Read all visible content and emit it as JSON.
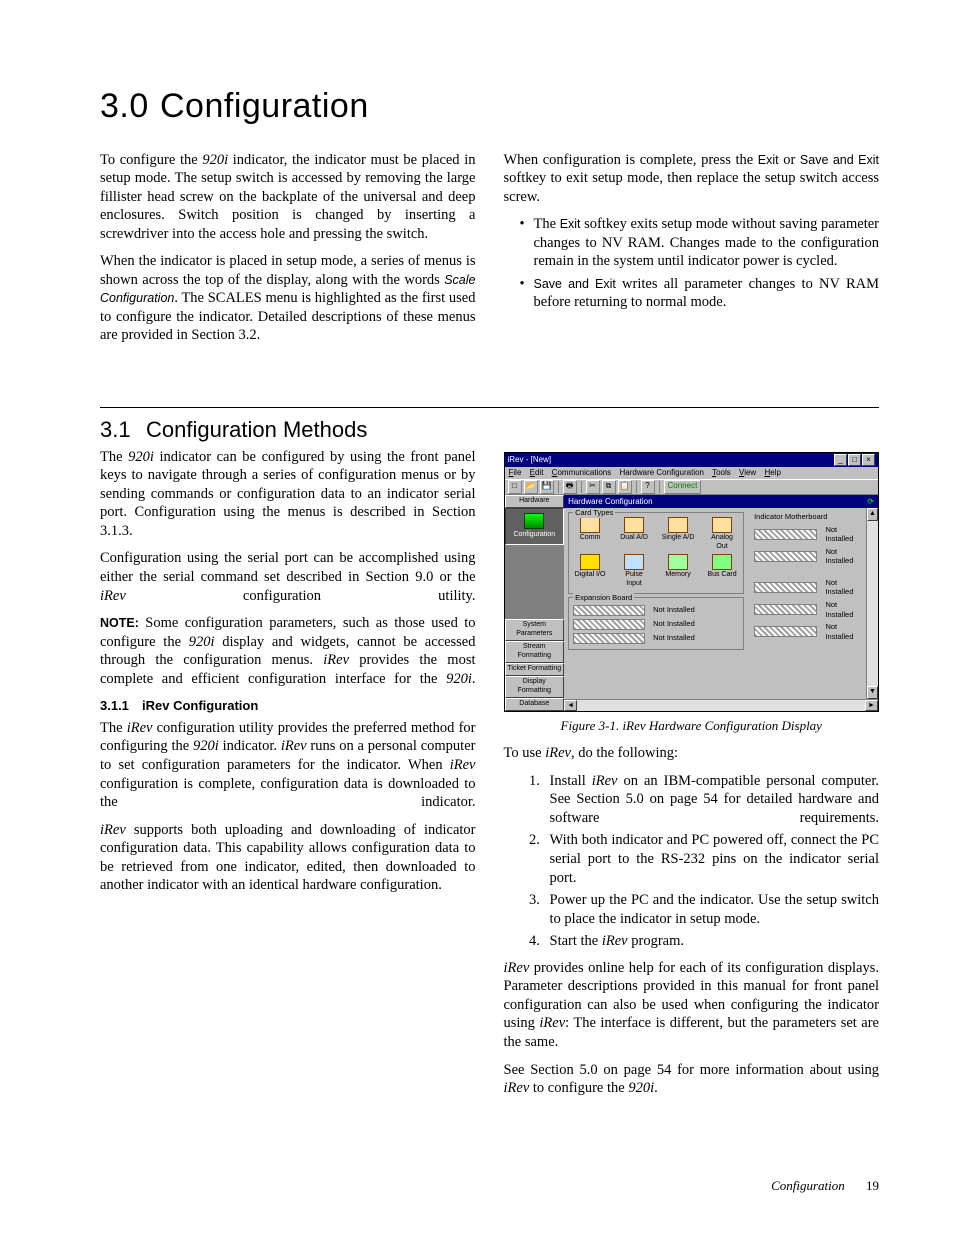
{
  "heading": {
    "num": "3.0",
    "title": "Configuration"
  },
  "intro": {
    "p1a": "To configure the ",
    "p1b": "920i",
    "p1c": " indicator, the indicator must be placed in setup mode. The setup switch is accessed by removing the large fillister head screw on the backplate of the universal and deep enclosures. Switch position is changed by inserting a screwdriver into the access hole and pressing the switch.",
    "p2a": "When the indicator is placed in setup mode, a series of menus is shown across the top of the display, along with the words ",
    "p2b": "Scale Configuration",
    "p2c": ". The SCALES menu is highlighted as the first used to configure the indicator. Detailed descriptions of these menus are provided in Section 3.2.",
    "rp1a": "When configuration is complete, press the ",
    "rp1b": "Exit",
    "rp1c": " or ",
    "rp1d": "Save and Exit",
    "rp1e": " softkey to exit setup mode, then replace the setup switch access screw.",
    "b1a": "The ",
    "b1b": "Exit",
    "b1c": " softkey exits setup mode without saving parameter changes to NV RAM. Changes made to the configuration remain in the system until indicator power is cycled.",
    "b2a": "Save and Exit",
    "b2b": " writes all parameter changes to NV RAM before returning to normal mode."
  },
  "sec31": {
    "num": "3.1",
    "title": "Configuration Methods",
    "p1a": "The ",
    "p1b": "920i",
    "p1c": " indicator can be configured by using the front panel keys to navigate through a series of configuration menus or by sending commands or configuration data to an indicator serial port. Configuration using the menus is described in Section 3.1.3.",
    "p2a": "Configuration using the serial port can be accomplished using either the serial command set described in Section 9.0 or the ",
    "p2b": "iRev",
    "p2c": " configuration utility.",
    "p3a": "NOTE:",
    "p3b": " Some configuration parameters, such as those used to configure the ",
    "p3c": "920i",
    "p3d": " display and widgets, cannot be accessed through the configuration menus. ",
    "p3e": "iRev",
    "p3f": " provides the most complete and efficient configuration interface for the ",
    "p3g": "920i",
    "p3h": "."
  },
  "sec311": {
    "num": "3.1.1",
    "title": "iRev Configuration",
    "p1a": "The ",
    "p1b": "iRev",
    "p1c": " configuration utility provides the preferred method for configuring the ",
    "p1d": "920i",
    "p1e": " indicator. ",
    "p1f": "iRev",
    "p1g": " runs on a personal computer to set configuration parameters for the indicator. When ",
    "p1h": "iRev",
    "p1i": " configuration is complete, configuration data is downloaded to the indicator.",
    "p2a": "iRev",
    "p2b": " supports both uploading and downloading of indicator configuration data. This capability allows configuration data to be retrieved from one indicator, edited, then downloaded to another indicator with an identical hardware configuration."
  },
  "fig": {
    "caption": "Figure 3-1. iRev Hardware Configuration Display",
    "title": "iRev - [New]",
    "menus": [
      "File",
      "Edit",
      "Communications",
      "Hardware Configuration",
      "Tools",
      "View",
      "Help"
    ],
    "connect": "Connect",
    "side_top": "Hardware",
    "side_conf": "Configuration",
    "side_items": [
      "System Parameters",
      "Stream Formatting",
      "Ticket Formatting",
      "Display Formatting",
      "Database"
    ],
    "content_title": "Hardware Configuration",
    "card_types": "Card Types",
    "icons": [
      "Comm",
      "Dual A/D",
      "Single A/D",
      "Analog Out",
      "Digital I/O",
      "Pulse Input",
      "Memory",
      "Bus Card"
    ],
    "exp_board": "Expansion Board",
    "mb": "Indicator Motherboard",
    "ni": "Not Installed"
  },
  "usage": {
    "lead_a": "To use ",
    "lead_b": "iRev",
    "lead_c": ", do the following:",
    "s1a": "Install ",
    "s1b": "iRev",
    "s1c": " on an IBM-compatible personal computer. See Section 5.0 on page 54 for detailed hardware and software requirements.",
    "s2": "With both indicator and PC powered off, connect the PC serial port to the RS-232 pins on the indicator serial port.",
    "s3": "Power up the PC and the indicator. Use the setup switch to place the indicator in setup mode.",
    "s4a": "Start the ",
    "s4b": "iRev",
    "s4c": " program.",
    "p_after_a": "iRev",
    "p_after_b": " provides online help for each of its configuration displays. Parameter descriptions provided in this manual for front panel configuration can also be used when configuring the indicator using ",
    "p_after_c": "iRev",
    "p_after_d": ": The interface is different, but the parameters set are the same.",
    "p_last_a": "See Section 5.0 on page 54 for more information about using ",
    "p_last_b": "iRev",
    "p_last_c": " to configure the ",
    "p_last_d": "920i",
    "p_last_e": "."
  },
  "footer": {
    "label": "Configuration",
    "page": "19"
  }
}
